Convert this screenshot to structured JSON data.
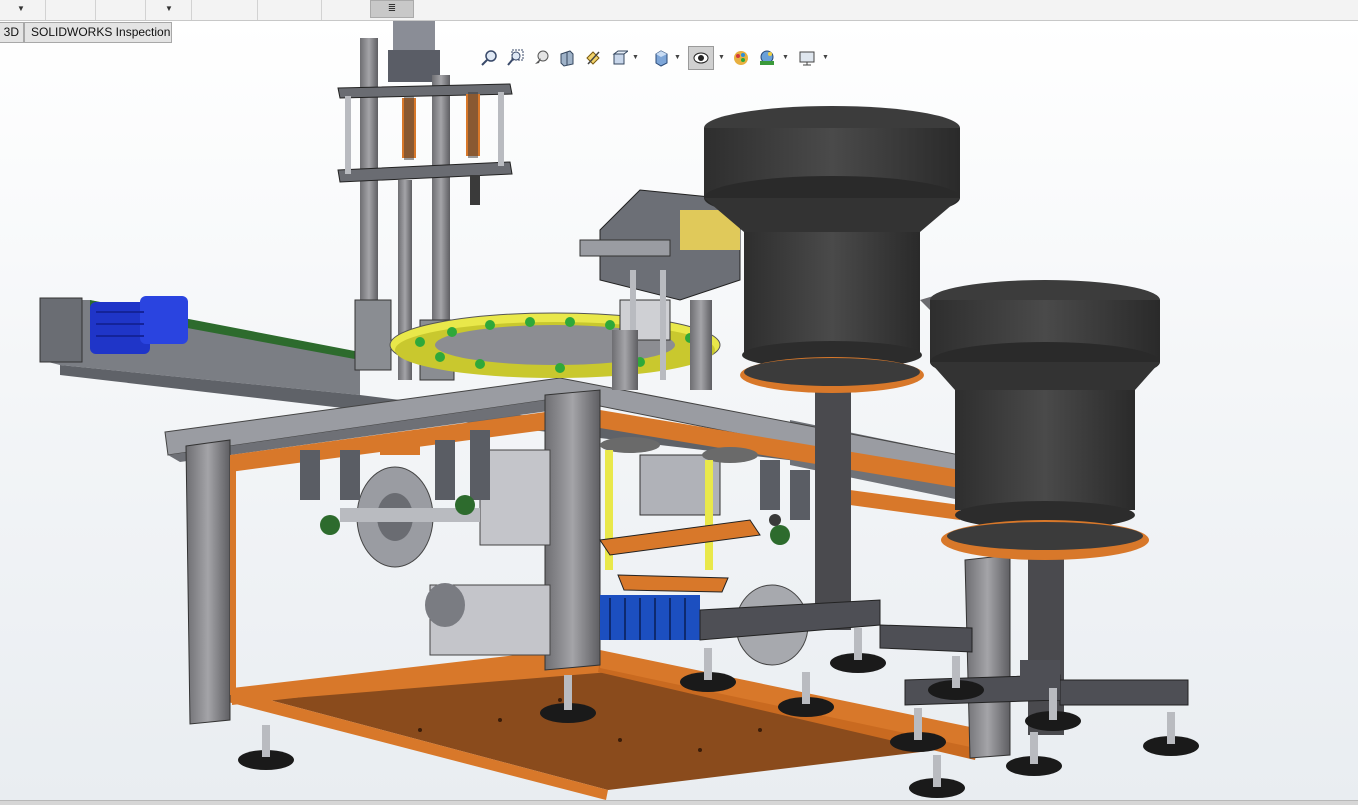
{
  "tabs": [
    {
      "label": "3D"
    },
    {
      "label": "SOLIDWORKS Inspection"
    }
  ],
  "topbar": {
    "pin_label": "≣"
  },
  "hud_icons": [
    "zoom-to-fit-icon",
    "zoom-to-area-icon",
    "previous-view-icon",
    "section-view-icon",
    "dynamic-annotation-icon",
    "view-orientation-icon",
    "display-style-icon",
    "hide-show-items-icon",
    "edit-appearance-icon",
    "apply-scene-icon",
    "view-settings-icon"
  ],
  "colors": {
    "frame_orange": "#d8782a",
    "frame_gray": "#8e9096",
    "hopper_dark": "#3a3a3a",
    "turntable_yellow": "#e9e84a",
    "motor_blue": "#1f35c8",
    "viewport_top": "#ffffff",
    "viewport_bottom": "#e9edf1"
  }
}
